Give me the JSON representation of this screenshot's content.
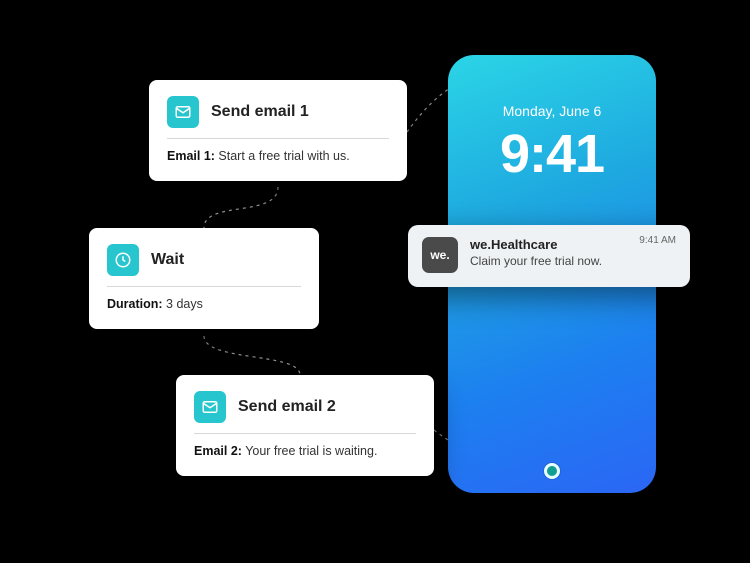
{
  "phone": {
    "date": "Monday, June 6",
    "time": "9:41"
  },
  "notification": {
    "app_icon_text": "we.",
    "app_name": "we.Healthcare",
    "message": "Claim your free trial now.",
    "time": "9:41 AM"
  },
  "flow": {
    "card1": {
      "title": "Send email 1",
      "detail_label": "Email 1:",
      "detail_value": "Start a free trial with us."
    },
    "card2": {
      "title": "Wait",
      "detail_label": "Duration:",
      "detail_value": "3 days"
    },
    "card3": {
      "title": "Send email 2",
      "detail_label": "Email 2:",
      "detail_value": "Your free trial is waiting."
    }
  }
}
